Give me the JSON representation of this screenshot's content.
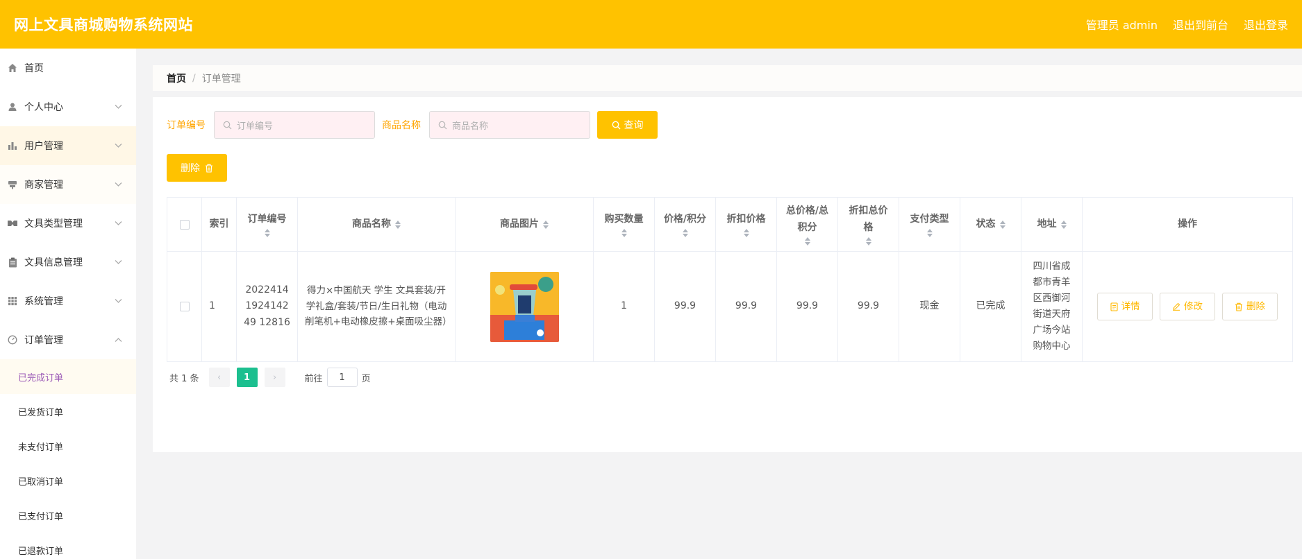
{
  "header": {
    "title": "网上文具商城购物系统网站",
    "user": "管理员 admin",
    "to_front": "退出到前台",
    "logout": "退出登录"
  },
  "sidebar": {
    "items": [
      {
        "label": "首页",
        "icon": "home-icon"
      },
      {
        "label": "个人中心",
        "icon": "user-icon"
      },
      {
        "label": "用户管理",
        "icon": "bar-chart-icon"
      },
      {
        "label": "商家管理",
        "icon": "store-icon"
      },
      {
        "label": "文具类型管理",
        "icon": "tag-icon"
      },
      {
        "label": "文具信息管理",
        "icon": "clipboard-icon"
      },
      {
        "label": "系统管理",
        "icon": "grid-icon"
      },
      {
        "label": "订单管理",
        "icon": "gauge-icon"
      }
    ],
    "sub_items": [
      {
        "label": "已完成订单"
      },
      {
        "label": "已发货订单"
      },
      {
        "label": "未支付订单"
      },
      {
        "label": "已取消订单"
      },
      {
        "label": "已支付订单"
      },
      {
        "label": "已退款订单"
      }
    ]
  },
  "breadcrumb": {
    "home": "首页",
    "sep": "/",
    "current": "订单管理"
  },
  "filters": {
    "order_label": "订单编号",
    "order_placeholder": "订单编号",
    "product_label": "商品名称",
    "product_placeholder": "商品名称",
    "query_button": "查询"
  },
  "actions": {
    "delete_button": "删除"
  },
  "table": {
    "headers": {
      "index": "索引",
      "order_no": "订单编号",
      "product_name": "商品名称",
      "product_image": "商品图片",
      "quantity": "购买数量",
      "price": "价格/积分",
      "discount_price": "折扣价格",
      "total_price": "总价格/总积分",
      "discount_total": "折扣总价格",
      "pay_type": "支付类型",
      "status": "状态",
      "address": "地址",
      "ops": "操作"
    },
    "rows": [
      {
        "index": "1",
        "order_no": "2022414192414249 12816",
        "product_name": "得力×中国航天 学生 文具套装/开学礼盒/套装/节日/生日礼物（电动削笔机+电动橡皮擦+桌面吸尘器）",
        "quantity": "1",
        "price": "99.9",
        "discount_price": "99.9",
        "total_price": "99.9",
        "discount_total": "99.9",
        "pay_type": "现金",
        "status": "已完成",
        "address": "四川省成都市青羊区西御河街道天府广场今站购物中心",
        "op_detail": "详情",
        "op_edit": "修改",
        "op_delete": "删除"
      }
    ]
  },
  "pagination": {
    "total": "共 1 条",
    "prev": "‹",
    "current_page": "1",
    "next": "›",
    "goto_prefix": "前往",
    "goto_value": "1",
    "goto_suffix": "页"
  },
  "colors": {
    "brand": "#ffc200",
    "pager_active": "#1cbf8f"
  }
}
